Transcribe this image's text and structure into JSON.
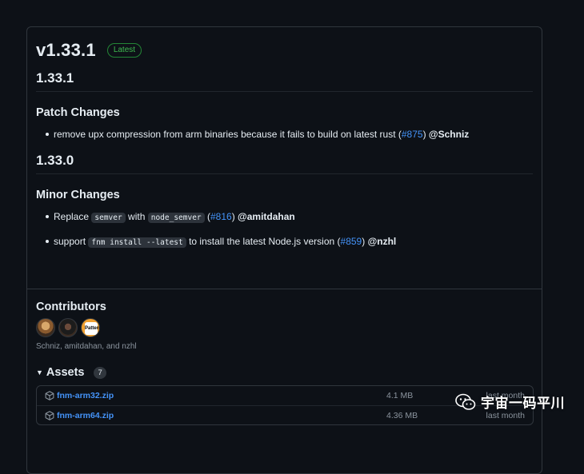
{
  "release": {
    "version": "v1.33.1",
    "badge": "Latest",
    "sections": [
      {
        "heading": "1.33.1",
        "subheading": "Patch Changes",
        "items": [
          {
            "text": "remove upx compression from arm binaries because it fails to build on latest rust (",
            "link": "#875",
            "after": ") ",
            "mention": "@Schniz"
          }
        ]
      },
      {
        "heading": "1.33.0",
        "subheading": "Minor Changes",
        "items": [
          {
            "pre": "Replace ",
            "code1": "semver",
            "mid": " with ",
            "code2": "node_semver",
            "after1": " (",
            "link": "#816",
            "after": ") ",
            "mention": "@amitdahan"
          },
          {
            "pre": "support ",
            "code1": "fnm install --latest",
            "mid": " to install the latest Node.js version (",
            "link": "#859",
            "after": ") ",
            "mention": "@nzhl"
          }
        ]
      }
    ]
  },
  "contributors": {
    "title": "Contributors",
    "names": "Schniz, amitdahan, and nzhl",
    "avatar3_text": "Pattern"
  },
  "assets": {
    "title": "Assets",
    "count": "7",
    "rows": [
      {
        "name": "fnm-arm32.zip",
        "size": "4.1 MB",
        "date": "last month"
      },
      {
        "name": "fnm-arm64.zip",
        "size": "4.36 MB",
        "date": "last month"
      }
    ]
  },
  "watermark": {
    "text": "宇宙一码平川"
  },
  "colors": {
    "background": "#0d1117",
    "link": "#4493f8",
    "badge": "#3fb950"
  }
}
